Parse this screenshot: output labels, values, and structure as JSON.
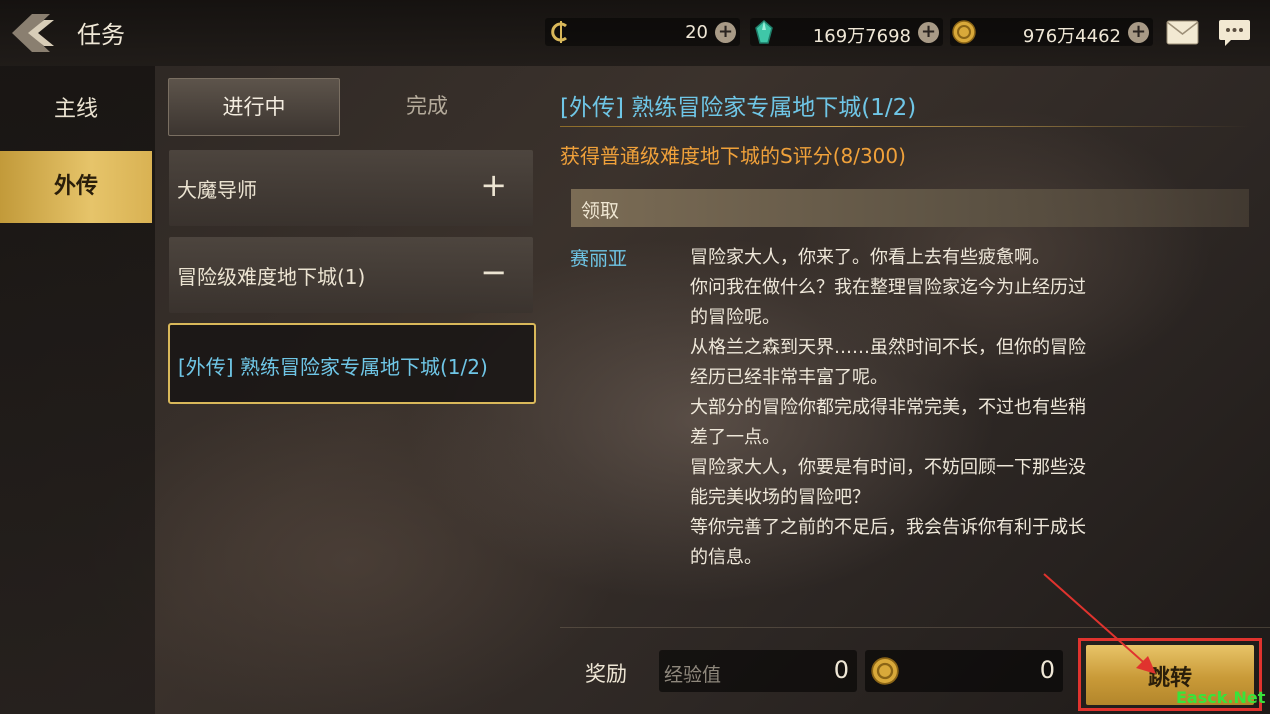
{
  "header": {
    "title": "任务",
    "currencies": [
      {
        "icon": "c-coin-icon",
        "value": "20"
      },
      {
        "icon": "crystal-icon",
        "value": "169万7698"
      },
      {
        "icon": "gold-coin-icon",
        "value": "976万4462"
      }
    ],
    "icons": [
      "mail-icon",
      "chat-icon"
    ]
  },
  "sidebar": {
    "items": [
      {
        "label": "主线",
        "active": false
      },
      {
        "label": "外传",
        "active": true
      }
    ]
  },
  "tabs": [
    {
      "label": "进行中",
      "active": true
    },
    {
      "label": "完成",
      "active": false
    }
  ],
  "quest_list": {
    "categories": [
      {
        "label": "大魔导师",
        "symbol": "+"
      },
      {
        "label": "冒险级难度地下城(1)",
        "symbol": "−"
      }
    ],
    "selected": {
      "label": "[外传] 熟练冒险家专属地下城(1/2)"
    }
  },
  "detail": {
    "title": "[外传] 熟练冒险家专属地下城(1/2)",
    "objective": "获得普通级难度地下城的S评分(8/300)",
    "claim_label": "领取",
    "speaker": "赛丽亚",
    "dialogue": "冒险家大人，你来了。你看上去有些疲惫啊。\n你问我在做什么？我在整理冒险家迄今为止经历过\n的冒险呢。\n从格兰之森到天界……虽然时间不长，但你的冒险\n经历已经非常丰富了呢。\n大部分的冒险你都完成得非常完美，不过也有些稍\n差了一点。\n冒险家大人，你要是有时间，不妨回顾一下那些没\n能完美收场的冒险吧？\n等你完善了之前的不足后，我会告诉你有利于成长\n的信息。"
  },
  "rewards": {
    "label": "奖励",
    "exp": {
      "name": "经验值",
      "value": "0"
    },
    "gold": {
      "icon": "gold-coin-icon",
      "value": "0"
    }
  },
  "jump_button": {
    "label": "跳转"
  },
  "watermark": "Easck.Net",
  "colors": {
    "accent_gold": "#d9b85a",
    "quest_blue": "#6fc6e6",
    "objective_orange": "#f0a13a",
    "highlight_red": "#e0332e"
  }
}
